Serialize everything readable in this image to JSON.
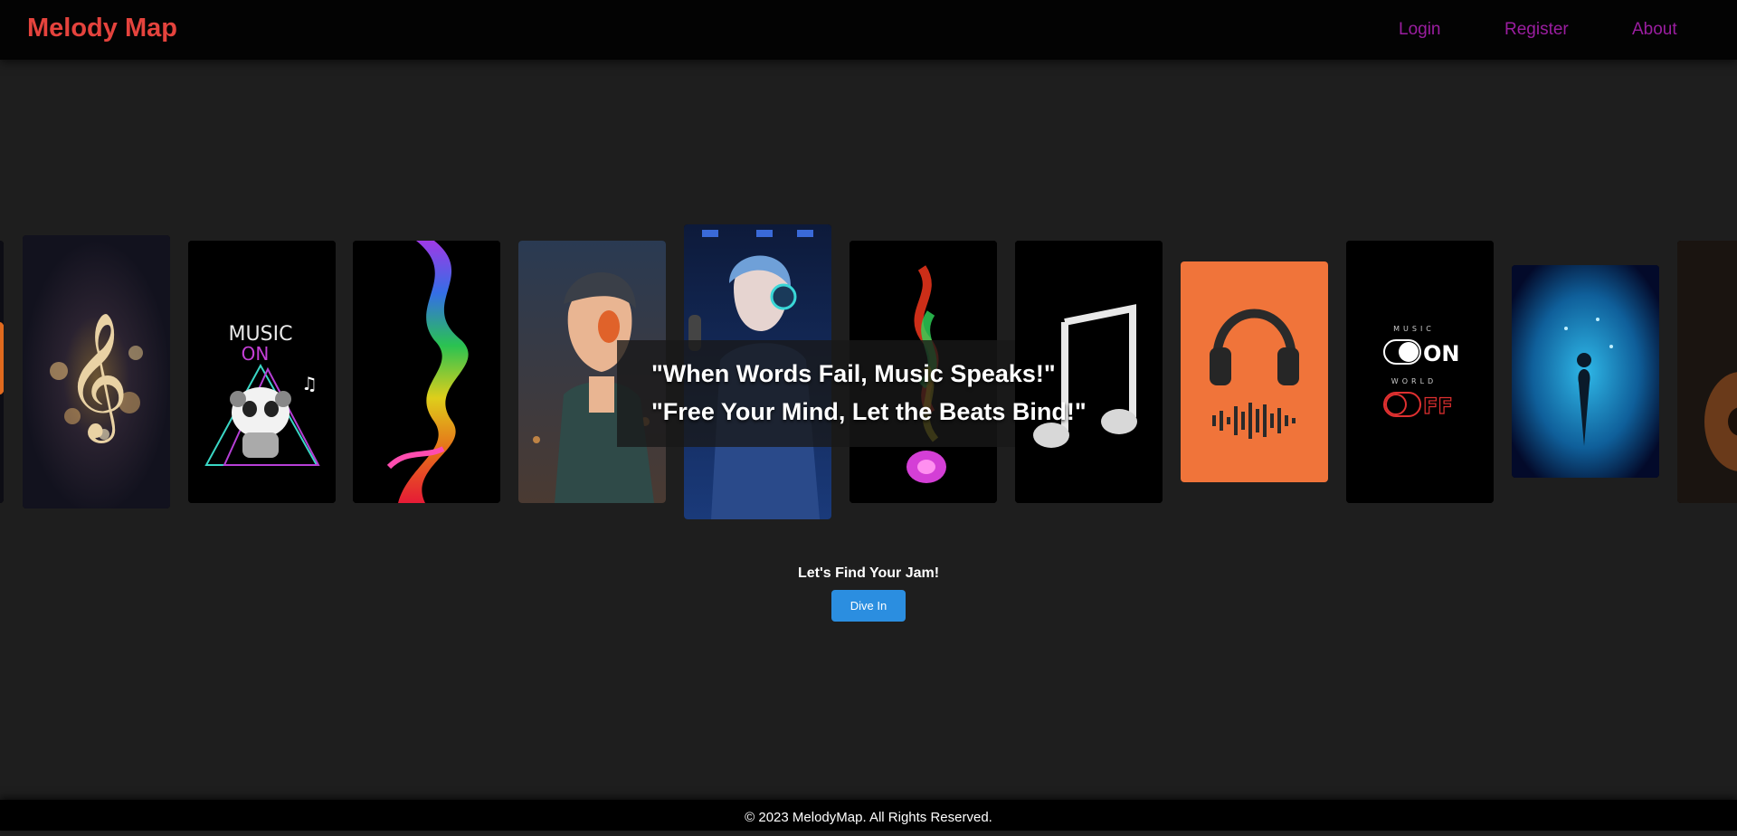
{
  "header": {
    "brand": "Melody Map",
    "nav": [
      {
        "label": "Login"
      },
      {
        "label": "Register"
      },
      {
        "label": "About"
      }
    ]
  },
  "gallery": {
    "cards": [
      {
        "name": "partial-edge-card",
        "icon": "music-art-image"
      },
      {
        "name": "golden-treble-clef-card",
        "icon": "treble-clef-image"
      },
      {
        "name": "music-on-panda-card",
        "icon": "panda-headphones-image"
      },
      {
        "name": "rainbow-smoke-card",
        "icon": "rainbow-smoke-image"
      },
      {
        "name": "anime-boy-headphones-card",
        "icon": "anime-boy-image"
      },
      {
        "name": "anime-singer-studio-card",
        "icon": "anime-singer-image"
      },
      {
        "name": "colorful-smoke-note-card",
        "icon": "colorful-note-image"
      },
      {
        "name": "white-music-note-card",
        "icon": "music-note-image"
      },
      {
        "name": "orange-headphones-card",
        "icon": "headphones-image"
      },
      {
        "name": "music-on-world-off-card",
        "icon": "toggle-switch-image"
      },
      {
        "name": "blue-fantasy-card",
        "icon": "fantasy-art-image"
      },
      {
        "name": "guitar-partial-card",
        "icon": "guitar-image"
      }
    ],
    "panda_card_text": {
      "line1": "MUSIC",
      "line2": "ON"
    },
    "switch_card_text": {
      "top": "MUSIC",
      "on": "ON",
      "middle": "WORLD",
      "off": "FF"
    }
  },
  "quotes": {
    "line1": "\"When Words Fail, Music Speaks!\"",
    "line2": "\"Free Your Mind, Let the Beats Bind!\""
  },
  "cta": {
    "text": "Let's Find Your Jam!",
    "button_label": "Dive In"
  },
  "footer": {
    "text": "© 2023 MelodyMap. All Rights Reserved."
  },
  "colors": {
    "background": "#1e1e1e",
    "topbar": "#030303",
    "brand": "#e5433d",
    "nav_link": "#9b1ea0",
    "button": "#2b8ee0"
  }
}
